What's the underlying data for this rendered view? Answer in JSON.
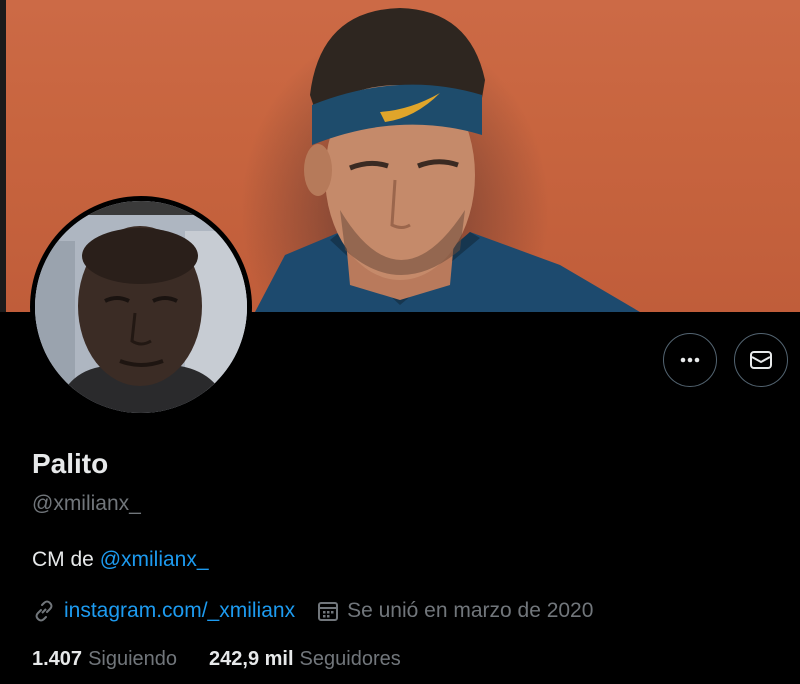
{
  "profile": {
    "name": "Palito",
    "handle": "@xmilianx_",
    "bio_prefix": "CM de ",
    "bio_mention": "@xmilianx_",
    "link": "instagram.com/_xmilianx",
    "joined": "Se unió en marzo de 2020"
  },
  "stats": {
    "following_count": "1.407",
    "following_label": "Siguiendo",
    "followers_count": "242,9 mil",
    "followers_label": "Seguidores"
  },
  "icons": {
    "more": "more-options-icon",
    "message": "envelope-icon",
    "link": "link-icon",
    "calendar": "calendar-icon"
  },
  "colors": {
    "accent": "#1d9bf0",
    "secondary_text": "#71767b",
    "primary_text": "#e7e9ea",
    "background": "#000000"
  }
}
